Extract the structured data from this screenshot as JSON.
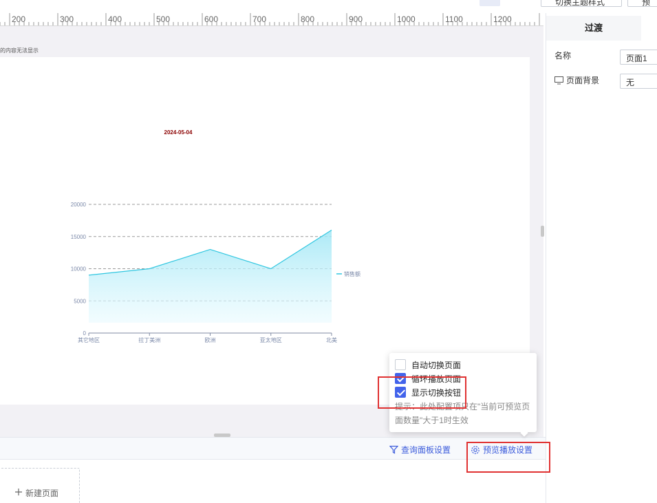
{
  "topbar": {
    "theme_button": "切换主题样式",
    "export_button": "预"
  },
  "ruler": {
    "labels": [
      "200",
      "300",
      "400",
      "500",
      "600",
      "700",
      "800",
      "900",
      "1000",
      "1100",
      "1200"
    ]
  },
  "canvas": {
    "notice_text": "的内容无法显示"
  },
  "chart_data": {
    "type": "area",
    "title": "2024-05-04",
    "categories": [
      "其它地区",
      "拉丁美洲",
      "欧洲",
      "亚太地区",
      "北美"
    ],
    "series": [
      {
        "name": "销售额",
        "values": [
          9000,
          10000,
          13000,
          10000,
          16000
        ]
      }
    ],
    "y_ticks": [
      "0",
      "5000",
      "10000",
      "15000",
      "20000"
    ],
    "ylim": [
      0,
      20000
    ],
    "grid": true,
    "legend_position": "right",
    "colors": {
      "line": "#2fc6e0",
      "title": "#8b0000",
      "grid": "#9a9a9a",
      "axis_text": "#7a88a8"
    }
  },
  "bottom_bar": {
    "query_panel_label": "查询面板设置",
    "preview_label": "预览播放设置"
  },
  "pages": {
    "new_page_label": "新建页面"
  },
  "right_panel": {
    "tab_label": "过渡",
    "name_label": "名称",
    "name_value": "页面1",
    "background_label": "页面背景",
    "background_value": "无"
  },
  "popover": {
    "options": [
      {
        "label": "自动切换页面",
        "checked": false
      },
      {
        "label": "循环播放页面",
        "checked": true
      },
      {
        "label": "显示切换按钮",
        "checked": true
      }
    ],
    "tip": "提示：此处配置项只在\"当前可预览页面数量\"大于1时生效"
  },
  "colors": {
    "accent": "#4263eb",
    "annotation": "#e03131"
  }
}
